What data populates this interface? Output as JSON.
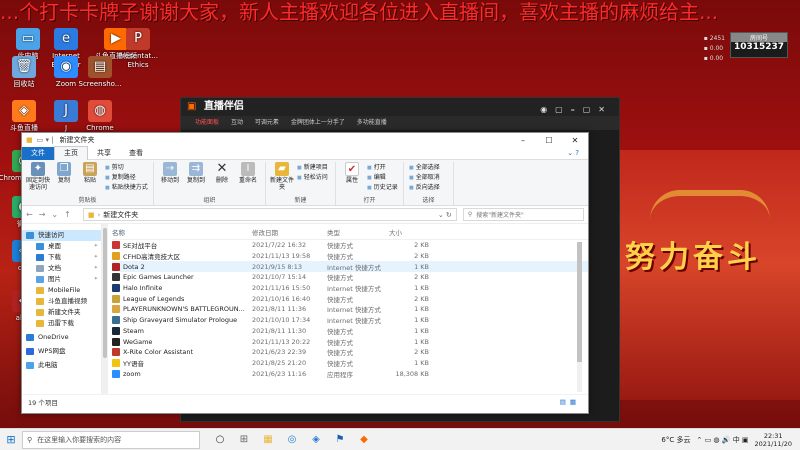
{
  "marquee": "...个打卡卡牌子谢谢大家，新人主播欢迎各位进入直播间，喜欢主播的麻烦给主...",
  "room": {
    "label": "房间号",
    "number": "10315237"
  },
  "desktop_icons": [
    {
      "label": "此电脑",
      "color": "#4aa3e8",
      "glyph": "▭"
    },
    {
      "label": "Internet Explorer",
      "color": "#2c7be0",
      "glyph": "e"
    },
    {
      "label": "斗鱼直播视频",
      "color": "#ff6a00",
      "glyph": "▶"
    },
    {
      "label": "Presentat... Ethics",
      "color": "#c0392b",
      "glyph": "P"
    },
    {
      "label": "回收站",
      "color": "#6fa8dc",
      "glyph": "🗑"
    },
    {
      "label": "Zoom",
      "color": "#2d8cff",
      "glyph": "◉"
    },
    {
      "label": "Screensho...",
      "color": "#a0522d",
      "glyph": "▤"
    },
    {
      "label": "斗鱼直播",
      "color": "#ff7a1a",
      "glyph": "◈"
    },
    {
      "label": "J",
      "color": "#3a7bd5",
      "glyph": "J"
    },
    {
      "label": "Chrome",
      "color": "#e04b3a",
      "glyph": "◍"
    },
    {
      "label": "Chrome 浏览器",
      "color": "#34a853",
      "glyph": "◍"
    },
    {
      "label": "微信",
      "color": "#2aae67",
      "glyph": "◐"
    },
    {
      "label": "ck..",
      "color": "#1d7fd6",
      "glyph": "◈"
    },
    {
      "label": "alive",
      "color": "#b22222",
      "glyph": "◆"
    }
  ],
  "stream_app": {
    "title": "直播伴侣",
    "tabs": [
      "功能面板",
      "互动",
      "可调元素",
      "金牌团体上一分手了",
      "多功能直播"
    ]
  },
  "explorer": {
    "title": "新建文件夹",
    "ribbon_tabs": [
      "文件",
      "主页",
      "共享",
      "查看"
    ],
    "groups": {
      "clipboard": {
        "label": "剪贴板",
        "pin": "固定到快速访问",
        "copy": "复制",
        "paste": "粘贴",
        "cut": "剪切",
        "copy_path": "复制路径",
        "paste_shortcut": "粘贴快捷方式"
      },
      "organize": {
        "label": "组织",
        "move_to": "移动到",
        "copy_to": "复制到",
        "delete": "删除",
        "rename": "重命名"
      },
      "new": {
        "label": "新建",
        "new_folder": "新建文件夹",
        "new_item": "新建项目",
        "easy_access": "轻松访问"
      },
      "open": {
        "label": "打开",
        "properties": "属性",
        "open": "打开",
        "edit": "编辑",
        "history": "历史记录"
      },
      "select": {
        "label": "选择",
        "select_all": "全部选择",
        "select_none": "全部取消",
        "invert": "反向选择"
      }
    },
    "address": "新建文件夹",
    "search_placeholder": "搜索\"新建文件夹\"",
    "nav": {
      "quick_access": "快速访问",
      "items": [
        {
          "label": "桌面",
          "color": "#3b8fd9",
          "pinned": true
        },
        {
          "label": "下载",
          "color": "#2a7bd3",
          "pinned": true
        },
        {
          "label": "文档",
          "color": "#8fa4bd",
          "pinned": true
        },
        {
          "label": "图片",
          "color": "#5aa3e0",
          "pinned": true
        },
        {
          "label": "MobileFile",
          "color": "#e8b73a",
          "pinned": false
        },
        {
          "label": "斗鱼直播视频",
          "color": "#e8b73a",
          "pinned": false
        },
        {
          "label": "新建文件夹",
          "color": "#e8b73a",
          "pinned": false
        },
        {
          "label": "迅雷下载",
          "color": "#e8b73a",
          "pinned": false
        }
      ],
      "onedrive": "OneDrive",
      "wps": "WPS网盘",
      "this_pc": "此电脑"
    },
    "columns": {
      "name": "名称",
      "date": "修改日期",
      "type": "类型",
      "size": "大小"
    },
    "files": [
      {
        "name": "SE对战平台",
        "date": "2021/7/22 16:32",
        "type": "快捷方式",
        "size": "2 KB",
        "color": "#c33"
      },
      {
        "name": "CFHD高清竞技大区",
        "date": "2021/11/13 19:58",
        "type": "快捷方式",
        "size": "2 KB",
        "color": "#e0a020"
      },
      {
        "name": "Dota 2",
        "date": "2021/9/15 8:13",
        "type": "Internet 快捷方式",
        "size": "1 KB",
        "color": "#b22222"
      },
      {
        "name": "Epic Games Launcher",
        "date": "2021/10/7 15:14",
        "type": "快捷方式",
        "size": "2 KB",
        "color": "#333"
      },
      {
        "name": "Halo Infinite",
        "date": "2021/11/16 15:50",
        "type": "Internet 快捷方式",
        "size": "1 KB",
        "color": "#1b3c6e"
      },
      {
        "name": "League of Legends",
        "date": "2021/10/16 16:40",
        "type": "快捷方式",
        "size": "2 KB",
        "color": "#c8a13b"
      },
      {
        "name": "PLAYERUNKNOWN'S BATTLEGROUN...",
        "date": "2021/8/11 11:36",
        "type": "Internet 快捷方式",
        "size": "1 KB",
        "color": "#d9a441"
      },
      {
        "name": "Ship Graveyard Simulator Prologue",
        "date": "2021/10/10 17:34",
        "type": "Internet 快捷方式",
        "size": "1 KB",
        "color": "#3a6e8f"
      },
      {
        "name": "Steam",
        "date": "2021/8/11 11:30",
        "type": "快捷方式",
        "size": "1 KB",
        "color": "#1b2838"
      },
      {
        "name": "WeGame",
        "date": "2021/11/13 20:22",
        "type": "快捷方式",
        "size": "1 KB",
        "color": "#222"
      },
      {
        "name": "X-Rite Color Assistant",
        "date": "2021/6/23 22:39",
        "type": "快捷方式",
        "size": "2 KB",
        "color": "#c0392b"
      },
      {
        "name": "YY语音",
        "date": "2021/8/25 21:20",
        "type": "快捷方式",
        "size": "1 KB",
        "color": "#f1c40f"
      },
      {
        "name": "zoom",
        "date": "2021/6/23 11:16",
        "type": "应用程序",
        "size": "18,308 KB",
        "color": "#2d8cff"
      }
    ],
    "status": "19 个项目"
  },
  "taskbar": {
    "search_placeholder": "在这里输入你要搜索的内容",
    "apps": [
      "○",
      "⊞",
      "▦",
      "◎",
      "◈",
      "⚑",
      "◆"
    ],
    "weather": "6°C 多云",
    "time": "22:31",
    "date": "2021/11/20"
  }
}
